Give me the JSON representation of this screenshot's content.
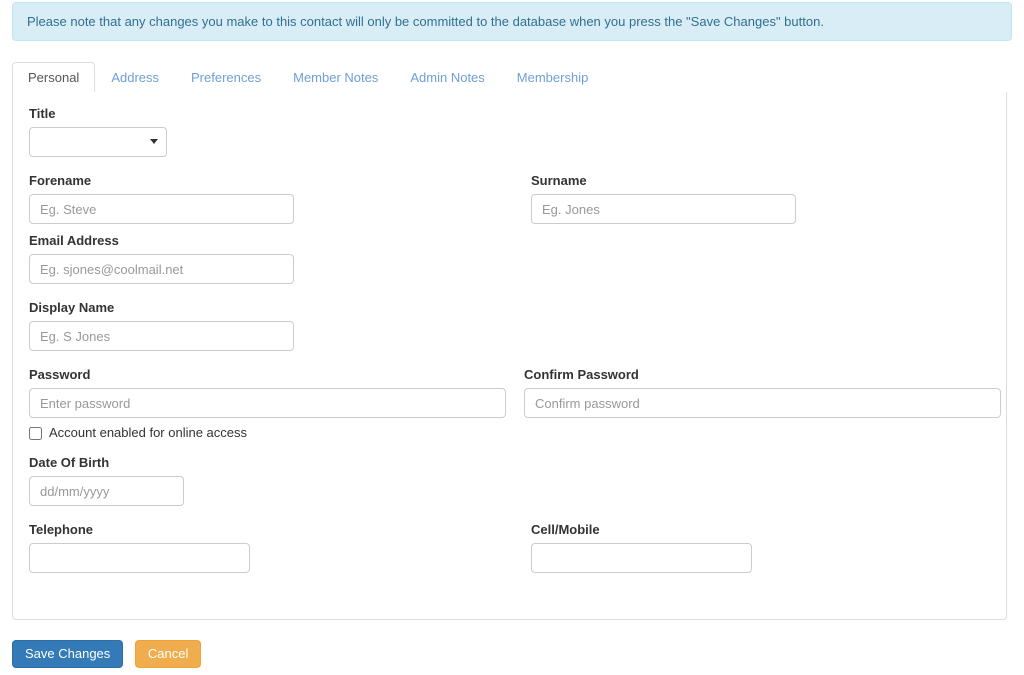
{
  "alert": {
    "message": "Please note that any changes you make to this contact will only be committed to the database when you press the \"Save Changes\" button.",
    "bg_color": "#d9edf7",
    "border_color": "#bce8f1",
    "text_color": "#31708f"
  },
  "tabs": [
    {
      "label": "Personal",
      "active": true
    },
    {
      "label": "Address",
      "active": false
    },
    {
      "label": "Preferences",
      "active": false
    },
    {
      "label": "Member Notes",
      "active": false
    },
    {
      "label": "Admin Notes",
      "active": false
    },
    {
      "label": "Membership",
      "active": false
    }
  ],
  "form": {
    "title": {
      "label": "Title",
      "value": "",
      "options": [
        ""
      ]
    },
    "forename": {
      "label": "Forename",
      "value": "",
      "placeholder": "Eg. Steve"
    },
    "surname": {
      "label": "Surname",
      "value": "",
      "placeholder": "Eg. Jones"
    },
    "email": {
      "label": "Email Address",
      "value": "",
      "placeholder": "Eg. sjones@coolmail.net"
    },
    "display_name": {
      "label": "Display Name",
      "value": "",
      "placeholder": "Eg. S Jones"
    },
    "password": {
      "label": "Password",
      "value": "",
      "placeholder": "Enter password"
    },
    "confirm_password": {
      "label": "Confirm Password",
      "value": "",
      "placeholder": "Confirm password"
    },
    "online_access": {
      "label": "Account enabled for online access",
      "checked": false
    },
    "date_of_birth": {
      "label": "Date Of Birth",
      "value": "",
      "placeholder": "dd/mm/yyyy"
    },
    "telephone": {
      "label": "Telephone",
      "value": "",
      "placeholder": ""
    },
    "cell_mobile": {
      "label": "Cell/Mobile",
      "value": "",
      "placeholder": ""
    }
  },
  "actions": {
    "save_label": "Save Changes",
    "cancel_label": "Cancel",
    "save_color": "#337ab7",
    "cancel_color": "#f0ad4e"
  }
}
